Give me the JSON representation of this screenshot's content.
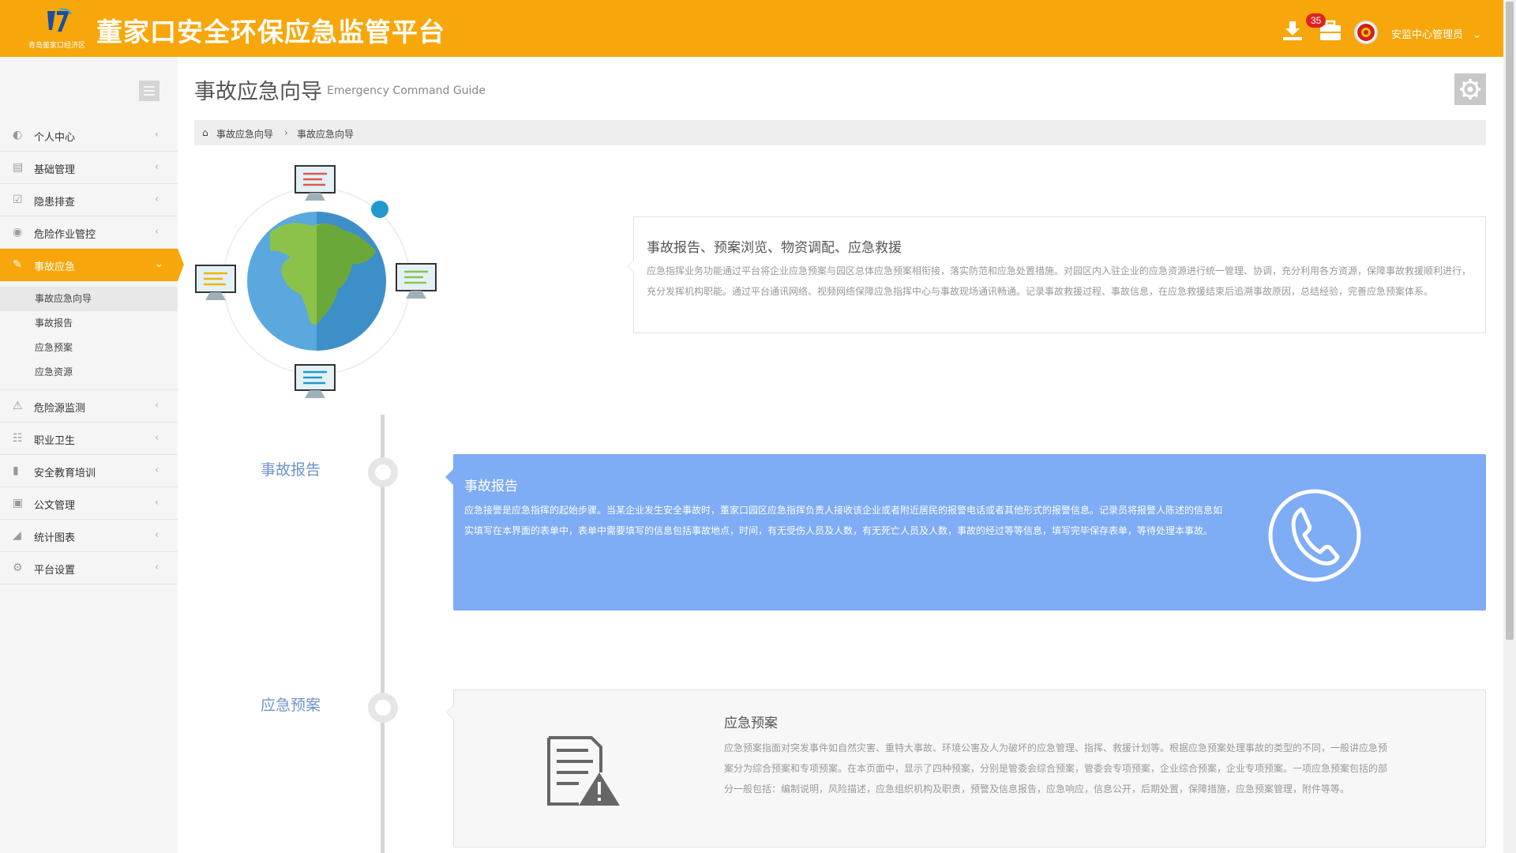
{
  "header": {
    "logo_subtext": "青岛董家口经济区",
    "title": "董家口安全环保应急监管平台",
    "badge_count": "35",
    "username": "安监中心管理员",
    "bg_color": "#f7a70b"
  },
  "sidebar": {
    "items": [
      {
        "label": "个人中心",
        "icon": "dashboard-icon"
      },
      {
        "label": "基础管理",
        "icon": "briefcase-icon"
      },
      {
        "label": "隐患排查",
        "icon": "calendar-check-icon"
      },
      {
        "label": "危险作业管控",
        "icon": "eye-icon"
      },
      {
        "label": "事故应急",
        "icon": "wrench-icon",
        "active": true
      },
      {
        "label": "危险源监测",
        "icon": "warning-icon"
      },
      {
        "label": "职业卫生",
        "icon": "clipboard-icon"
      },
      {
        "label": "安全教育培训",
        "icon": "book-icon"
      },
      {
        "label": "公文管理",
        "icon": "document-icon"
      },
      {
        "label": "统计图表",
        "icon": "area-chart-icon"
      },
      {
        "label": "平台设置",
        "icon": "gear-icon"
      }
    ],
    "submenu": [
      {
        "label": "事故应急向导",
        "active": true
      },
      {
        "label": "事故报告"
      },
      {
        "label": "应急预案"
      },
      {
        "label": "应急资源"
      }
    ]
  },
  "main": {
    "title": "事故应急向导",
    "subtitle": "Emergency Command Guide",
    "breadcrumb": [
      "事故应急向导",
      "事故应急向导"
    ],
    "intro": {
      "heading": "事故报告、预案浏览、物资调配、应急救援",
      "text": "应急指挥业务功能通过平台将企业应急预案与园区总体应急预案相衔接，落实防范和应急处置措施。对园区内入驻企业的应急资源进行统一管理、协调，充分利用各方资源，保障事故救援顺利进行，充分发挥机构职能。通过平台通讯网络、视频网络保障应急指挥中心与事故现场通讯畅通。记录事故救援过程、事故信息，在应急救援结束后追溯事故原因，总结经验，完善应急预案体系。"
    },
    "timeline": [
      {
        "label": "事故报告",
        "heading": "事故报告",
        "text": "应急接警是应急指挥的起始步骤。当某企业发生安全事故时，董家口园区应急指挥负责人接收该企业或者附近居民的报警电话或者其他形式的报警信息。记录员将报警人陈述的信息如实填写在本界面的表单中，表单中需要填写的信息包括事故地点，时间，有无受伤人员及人数，有无死亡人员及人数，事故的经过等等信息，填写完毕保存表单，等待处理本事故。",
        "icon": "phone-icon"
      },
      {
        "label": "应急预案",
        "heading": "应急预案",
        "text": "应急预案指面对突发事件如自然灾害、重特大事故、环境公害及人为破坏的应急管理、指挥、救援计划等。根据应急预案处理事故的类型的不同，一般讲应急预案分为综合预案和专项预案。在本页面中，显示了四种预案，分别是管委会综合预案，管委会专项预案，企业综合预案，企业专项预案。一项应急预案包括的部分一般包括：编制说明，风险描述，应急组织机构及职责，预警及信息报告，应急响应，信息公开，后期处置，保障措施，应急预案管理，附件等等。",
        "icon": "document-warning-icon"
      }
    ]
  }
}
